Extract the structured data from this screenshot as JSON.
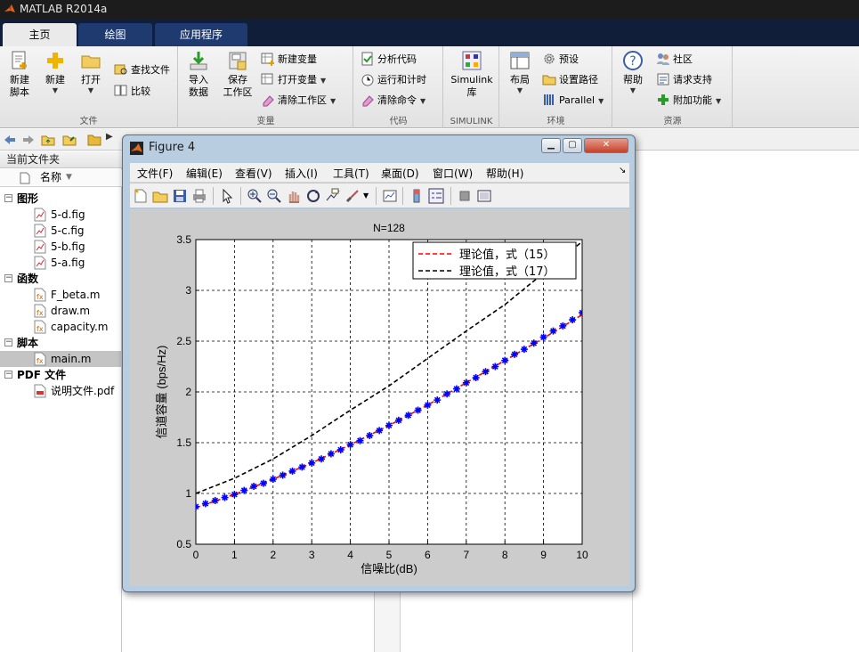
{
  "app": {
    "title": "MATLAB R2014a"
  },
  "tabs": [
    {
      "label": "主页",
      "active": true
    },
    {
      "label": "绘图",
      "active": false
    },
    {
      "label": "应用程序",
      "active": false
    }
  ],
  "ribbon": {
    "file": {
      "new_script": "新建\n脚本",
      "new": "新建",
      "open": "打开",
      "find_files": "查找文件",
      "compare": "比较",
      "group": "文件"
    },
    "variable": {
      "import": "导入\n数据",
      "save_ws": "保存\n工作区",
      "new_var": "新建变量",
      "open_var": "打开变量",
      "clear_ws": "清除工作区",
      "group": "变量"
    },
    "code": {
      "analyze": "分析代码",
      "run_time": "运行和计时",
      "clear_cmd": "清除命令",
      "group": "代码"
    },
    "simulink": {
      "lib": "Simulink\n库",
      "group": "SIMULINK"
    },
    "env": {
      "layout": "布局",
      "prefs": "预设",
      "set_path": "设置路径",
      "parallel": "Parallel",
      "group": "环境"
    },
    "resources": {
      "help": "帮助",
      "community": "社区",
      "support": "请求支持",
      "addons": "附加功能",
      "group": "资源"
    }
  },
  "left_panel": {
    "title": "当前文件夹",
    "col_name": "名称",
    "groups": [
      {
        "label": "图形",
        "files": [
          "5-d.fig",
          "5-c.fig",
          "5-b.fig",
          "5-a.fig"
        ]
      },
      {
        "label": "函数",
        "files": [
          "F_beta.m",
          "draw.m",
          "capacity.m"
        ]
      },
      {
        "label": "脚本",
        "files": [
          "main.m"
        ]
      },
      {
        "label": "PDF 文件",
        "files": [
          "说明文件.pdf"
        ]
      }
    ],
    "selected": "main.m"
  },
  "figure": {
    "title": "Figure 4",
    "menus": [
      "文件(F)",
      "编辑(E)",
      "查看(V)",
      "插入(I)",
      "工具(T)",
      "桌面(D)",
      "窗口(W)",
      "帮助(H)"
    ]
  },
  "chart_data": {
    "type": "line",
    "title": "N=128",
    "xlabel": "信噪比(dB)",
    "ylabel": "信道容量 (bps/Hz)",
    "xlim": [
      0,
      10
    ],
    "ylim": [
      0.5,
      3.5
    ],
    "xticks": [
      "0",
      "1",
      "2",
      "3",
      "4",
      "5",
      "6",
      "7",
      "8",
      "9",
      "10"
    ],
    "yticks": [
      "0.5",
      "1",
      "1.5",
      "2",
      "2.5",
      "3",
      "3.5"
    ],
    "grid": true,
    "legend_position": "top-right",
    "legend": [
      "理论值，式（15）",
      "理论值，式（17）"
    ],
    "series": [
      {
        "name": "理论值，式（15）",
        "color": "#ff0000",
        "style": "dashed",
        "x": [
          0,
          1,
          2,
          3,
          4,
          5,
          6,
          7,
          8,
          9,
          10
        ],
        "y": [
          0.86,
          0.99,
          1.14,
          1.3,
          1.48,
          1.67,
          1.87,
          2.09,
          2.31,
          2.53,
          2.76
        ]
      },
      {
        "name": "理论值，式（17）",
        "color": "#000000",
        "style": "dashed",
        "x": [
          0,
          1,
          2,
          3,
          4,
          5,
          6,
          7,
          8,
          9,
          10
        ],
        "y": [
          1.0,
          1.15,
          1.34,
          1.57,
          1.82,
          2.06,
          2.33,
          2.6,
          2.86,
          3.17,
          3.48
        ]
      },
      {
        "name": "",
        "color": "#0000ff",
        "style": "marker-star",
        "x": [
          0,
          0.25,
          0.5,
          0.75,
          1,
          1.25,
          1.5,
          1.75,
          2,
          2.25,
          2.5,
          2.75,
          3,
          3.25,
          3.5,
          3.75,
          4,
          4.25,
          4.5,
          4.75,
          5,
          5.25,
          5.5,
          5.75,
          6,
          6.25,
          6.5,
          6.75,
          7,
          7.25,
          7.5,
          7.75,
          8,
          8.25,
          8.5,
          8.75,
          9,
          9.25,
          9.5,
          9.75,
          10
        ],
        "y": [
          0.87,
          0.9,
          0.93,
          0.96,
          0.99,
          1.03,
          1.07,
          1.1,
          1.14,
          1.18,
          1.22,
          1.26,
          1.3,
          1.34,
          1.39,
          1.43,
          1.48,
          1.52,
          1.57,
          1.62,
          1.67,
          1.72,
          1.77,
          1.82,
          1.87,
          1.92,
          1.98,
          2.03,
          2.09,
          2.14,
          2.2,
          2.25,
          2.31,
          2.37,
          2.42,
          2.48,
          2.54,
          2.6,
          2.65,
          2.71,
          2.78
        ]
      }
    ]
  }
}
